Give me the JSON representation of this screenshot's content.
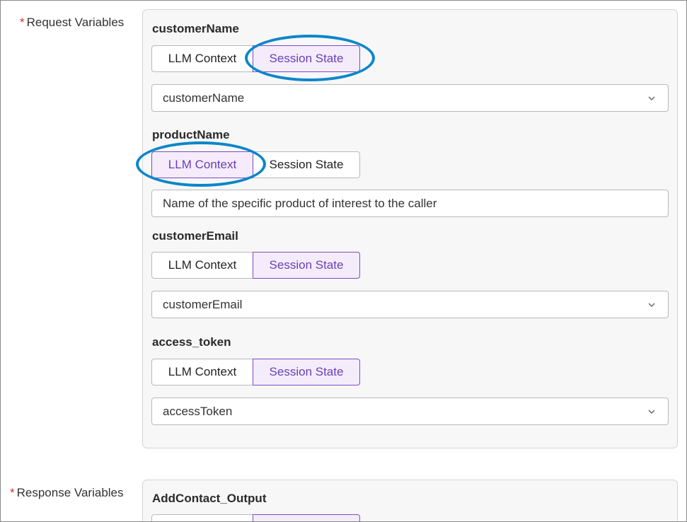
{
  "request": {
    "label": "Request Variables",
    "required_mark": "*",
    "variables": [
      {
        "name": "customerName",
        "toggle": {
          "llm": "LLM Context",
          "session": "Session State",
          "active": "session"
        },
        "value": "customerName",
        "kind": "select"
      },
      {
        "name": "productName",
        "toggle": {
          "llm": "LLM Context",
          "session": "Session State",
          "active": "llm"
        },
        "value": "Name of the specific product of interest to the caller",
        "kind": "text"
      },
      {
        "name": "customerEmail",
        "toggle": {
          "llm": "LLM Context",
          "session": "Session State",
          "active": "session"
        },
        "value": "customerEmail",
        "kind": "select"
      },
      {
        "name": "access_token",
        "toggle": {
          "llm": "LLM Context",
          "session": "Session State",
          "active": "session"
        },
        "value": "accessToken",
        "kind": "select"
      }
    ]
  },
  "response": {
    "label": "Response Variables",
    "required_mark": "*",
    "variables": [
      {
        "name": "AddContact_Output"
      }
    ]
  },
  "colors": {
    "accent": "#6a3fb5",
    "active_bg": "#f4ecfb",
    "highlight_ring": "#0d86c9",
    "required": "#d32f2f"
  },
  "icons": {
    "dropdown": "chevron-down-icon"
  }
}
